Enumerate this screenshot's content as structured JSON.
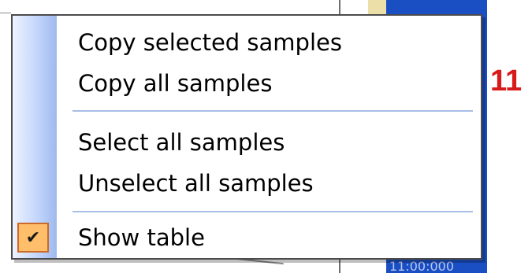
{
  "context_menu": {
    "items": [
      {
        "label": "Copy selected samples",
        "checked": false
      },
      {
        "label": "Copy all samples",
        "checked": false
      },
      {
        "label": "Select all samples",
        "checked": false
      },
      {
        "label": "Unselect all samples",
        "checked": false
      },
      {
        "label": "Show table",
        "checked": true
      }
    ],
    "check_glyph": "✔",
    "icons": {
      "check": "checkmark-icon"
    }
  },
  "annotation": {
    "text": "11",
    "color": "#d81a1a"
  },
  "background": {
    "timestamp_text": "11:00:000"
  },
  "colors": {
    "menu_gutter": "#c4d6fb",
    "separator": "#a8bde8",
    "check_fill": "#ffbe6a",
    "check_border": "#cc6a2a",
    "background_blue": "#1a4fc4"
  }
}
